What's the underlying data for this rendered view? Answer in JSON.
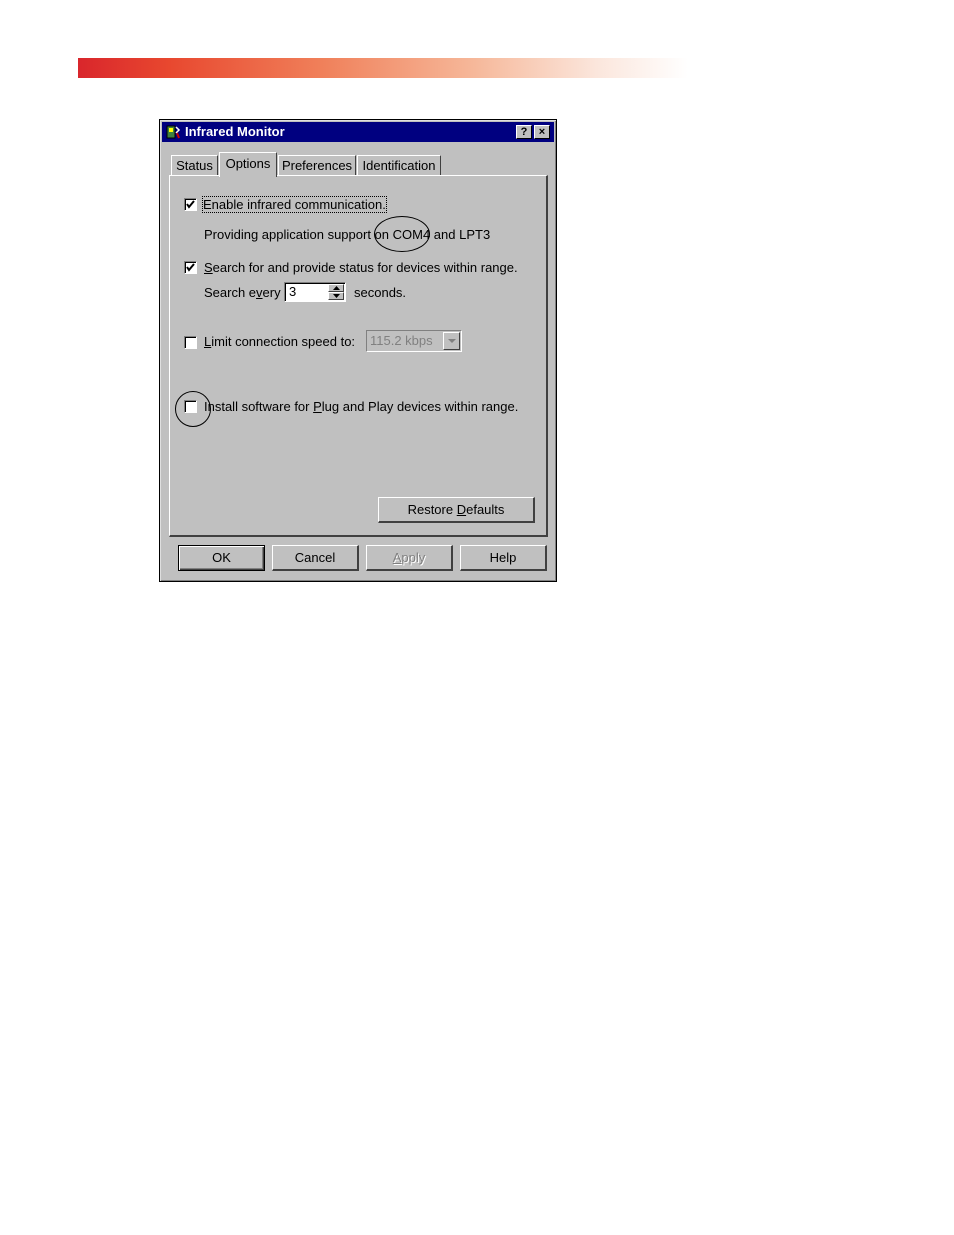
{
  "window": {
    "title": "Infrared Monitor",
    "help_glyph": "?",
    "close_glyph": "×"
  },
  "tabs": [
    {
      "label": "Status"
    },
    {
      "label": "Options"
    },
    {
      "label": "Preferences"
    },
    {
      "label": "Identification"
    }
  ],
  "active_tab": "Options",
  "options": {
    "enable": {
      "checked": true,
      "label": "Enable infrared communication."
    },
    "support": {
      "prefix": "Providing application support on ",
      "port1": "COM4",
      "middle": " and ",
      "port2": "LPT3"
    },
    "search": {
      "checked": true,
      "label_key": "S",
      "label_rest": "earch for and provide status for devices within range."
    },
    "interval": {
      "label_pre": "Search e",
      "label_key": "v",
      "label_post": "ery",
      "value": "3",
      "suffix": "seconds."
    },
    "limit_speed": {
      "checked": false,
      "label_key": "L",
      "label_rest": "imit connection speed to:",
      "selected": "115.2 kbps"
    },
    "install_pnp": {
      "checked": false,
      "label_key_pre": "Install software for ",
      "label_key": "P",
      "label_rest": "lug and Play devices within range."
    },
    "restore_label_pre": "Restore ",
    "restore_label_key": "D",
    "restore_label_post": "efaults"
  },
  "buttons": {
    "ok": "OK",
    "cancel": "Cancel",
    "apply_key": "A",
    "apply_rest": "pply",
    "help": "Help"
  },
  "colors": {
    "titlebar": "#000080",
    "face": "#c0c0c0",
    "banner_start": "#d9262c"
  }
}
